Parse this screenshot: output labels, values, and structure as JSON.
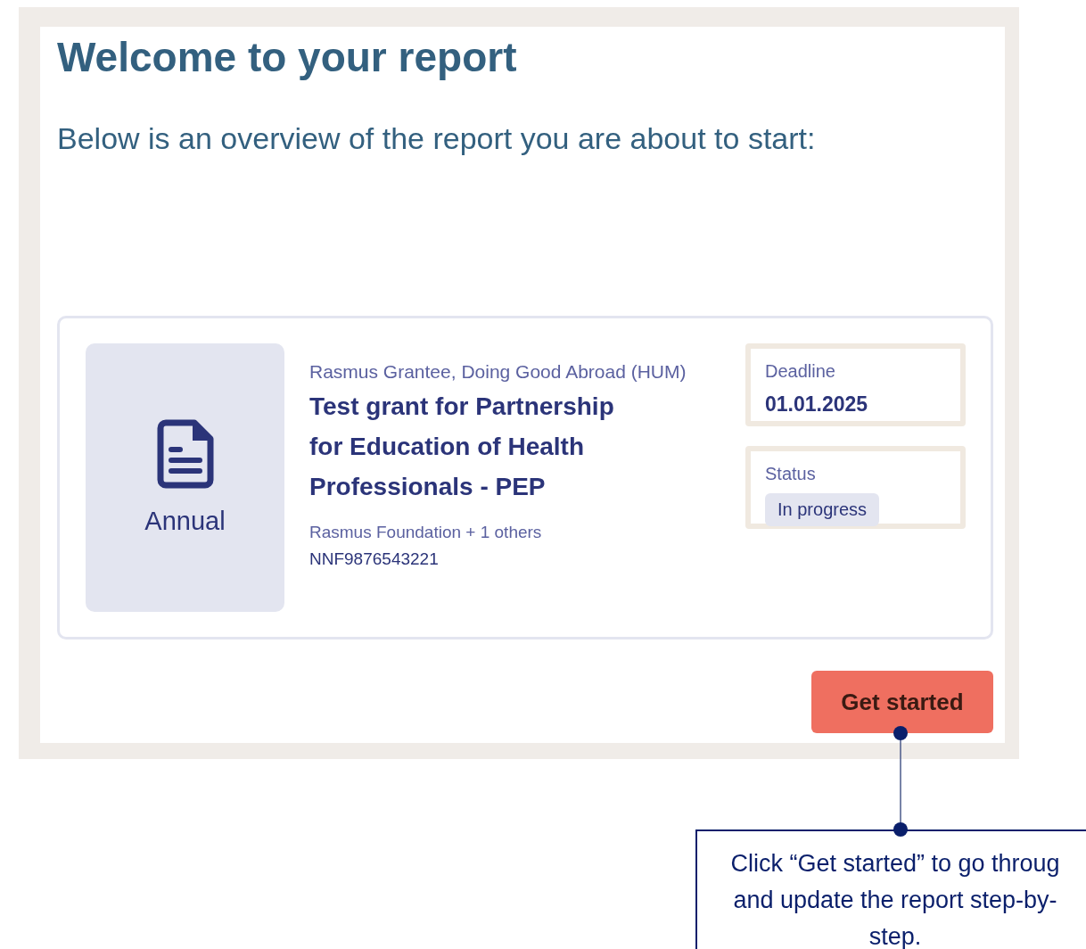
{
  "heading": "Welcome to your report",
  "intro": "Below is an overview of the report you are about to start:",
  "report": {
    "type": "Annual",
    "grantee": "Rasmus Grantee, Doing Good Abroad (HUM)",
    "title": "Test grant for Partnership for Education of Health Professionals - PEP",
    "foundation": "Rasmus Foundation + 1 others",
    "number": "NNF9876543221",
    "deadline": {
      "label": "Deadline",
      "value": "01.01.2025"
    },
    "status": {
      "label": "Status",
      "value": "In progress"
    }
  },
  "button": "Get started",
  "callout": {
    "lines": [
      "Click “Get started” to go throug",
      "and update the report step-by-",
      "step."
    ]
  }
}
